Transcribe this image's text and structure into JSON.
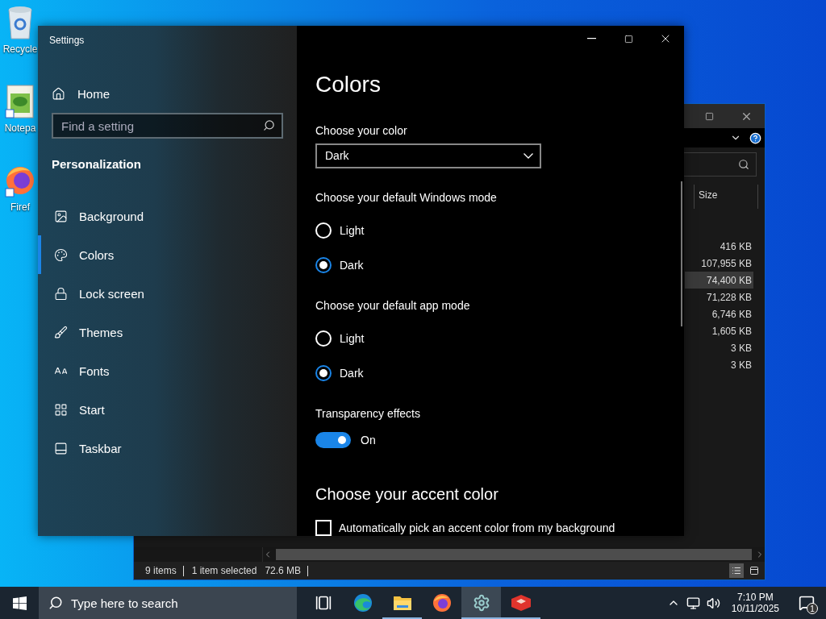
{
  "desktop_icons": [
    {
      "kind": "recycle-bin",
      "label": "Recycle"
    },
    {
      "kind": "notepad",
      "label": "Notepa"
    },
    {
      "kind": "firefox",
      "label": "Firef"
    }
  ],
  "explorer": {
    "column": "Size",
    "rows": [
      {
        "size": "416 KB",
        "selected": false
      },
      {
        "size": "107,955 KB",
        "selected": false
      },
      {
        "size": "74,400 KB",
        "selected": true
      },
      {
        "size": "71,228 KB",
        "selected": false
      },
      {
        "size": "6,746 KB",
        "selected": false
      },
      {
        "size": "1,605 KB",
        "selected": false
      },
      {
        "size": "3 KB",
        "selected": false
      },
      {
        "size": "3 KB",
        "selected": false
      }
    ],
    "status": {
      "items": "9 items",
      "selection": "1 item selected",
      "size": "72.6 MB"
    }
  },
  "settings": {
    "title": "Settings",
    "home": "Home",
    "search": {
      "placeholder": "Find a setting"
    },
    "section": "Personalization",
    "nav": [
      {
        "kind": "background",
        "label": "Background",
        "selected": false
      },
      {
        "kind": "colors",
        "label": "Colors",
        "selected": true
      },
      {
        "kind": "lock-screen",
        "label": "Lock screen",
        "selected": false
      },
      {
        "kind": "themes",
        "label": "Themes",
        "selected": false
      },
      {
        "kind": "fonts",
        "label": "Fonts",
        "selected": false
      },
      {
        "kind": "start",
        "label": "Start",
        "selected": false
      },
      {
        "kind": "taskbar",
        "label": "Taskbar",
        "selected": false
      }
    ],
    "page_title": "Colors",
    "color": {
      "label": "Choose your color",
      "value": "Dark"
    },
    "modes": [
      {
        "label": "Choose your default Windows mode",
        "options": [
          {
            "label": "Light",
            "selected": false
          },
          {
            "label": "Dark",
            "selected": true
          }
        ]
      },
      {
        "label": "Choose your default app mode",
        "options": [
          {
            "label": "Light",
            "selected": false
          },
          {
            "label": "Dark",
            "selected": true
          }
        ]
      }
    ],
    "transparency": {
      "label": "Transparency effects",
      "on": true,
      "state": "On"
    },
    "accent_heading": "Choose your accent color",
    "auto_accent": {
      "label": "Automatically pick an accent color from my background",
      "checked": false
    }
  },
  "taskbar": {
    "search_placeholder": "Type here to search",
    "apps": [
      {
        "kind": "task-view",
        "running": false,
        "selected": false
      },
      {
        "kind": "edge",
        "running": false,
        "selected": false
      },
      {
        "kind": "file-explorer",
        "running": true,
        "selected": false
      },
      {
        "kind": "firefox",
        "running": false,
        "selected": false
      },
      {
        "kind": "settings",
        "running": true,
        "selected": true
      },
      {
        "kind": "red-app",
        "running": true,
        "selected": false
      }
    ],
    "time": "7:10 PM",
    "date": "10/11/2025",
    "notifications": "1"
  }
}
